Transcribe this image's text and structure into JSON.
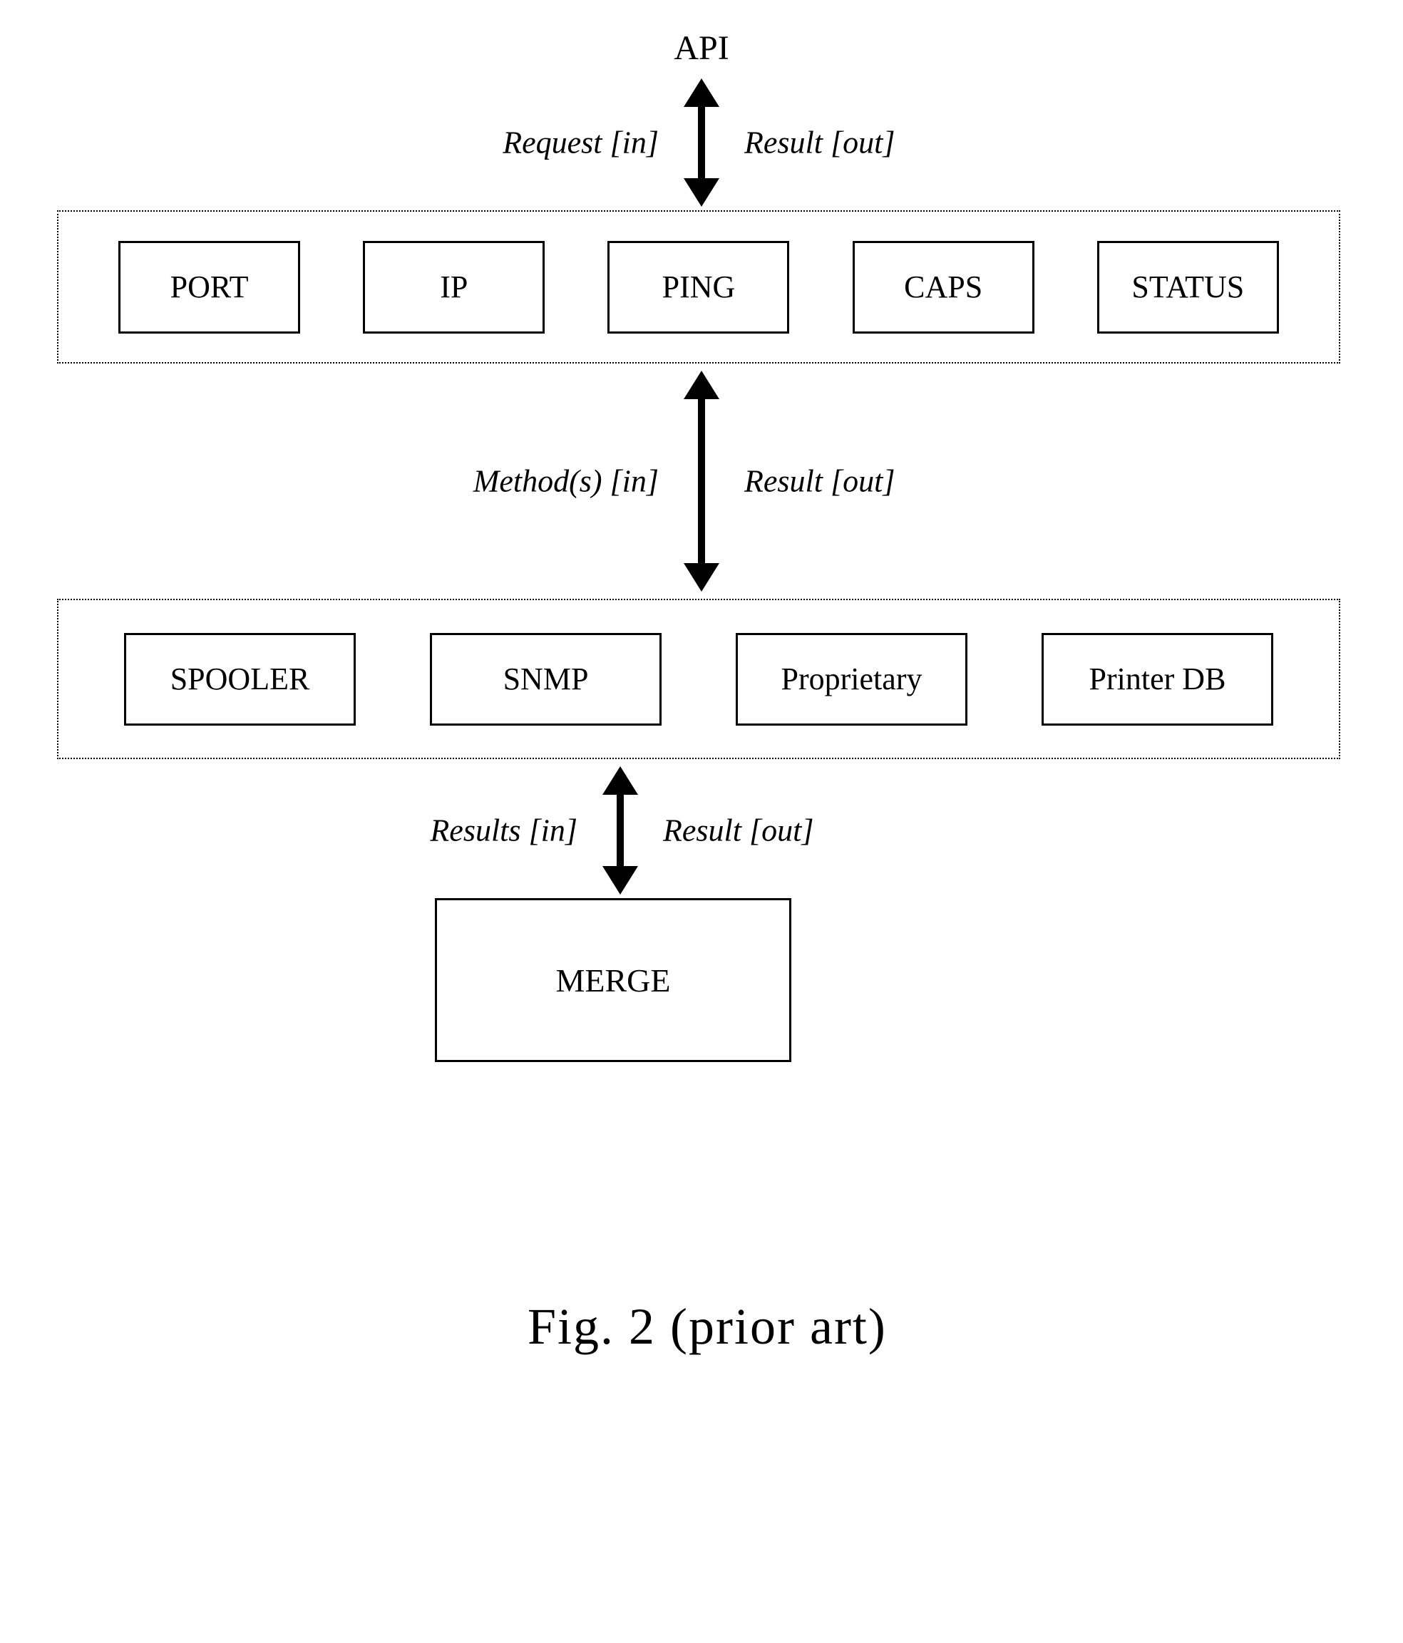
{
  "api_label": "API",
  "arrows": {
    "a1": {
      "left": "Request [in]",
      "right": "Result [out]"
    },
    "a2": {
      "left": "Method(s) [in]",
      "right": "Result [out]"
    },
    "a3": {
      "left": "Results [in]",
      "right": "Result [out]"
    }
  },
  "top_row": {
    "b1": "PORT",
    "b2": "IP",
    "b3": "PING",
    "b4": "CAPS",
    "b5": "STATUS"
  },
  "bottom_row": {
    "b1": "SPOOLER",
    "b2": "SNMP",
    "b3": "Proprietary",
    "b4": "Printer DB"
  },
  "merge_label": "MERGE",
  "caption": "Fig. 2  (prior art)"
}
